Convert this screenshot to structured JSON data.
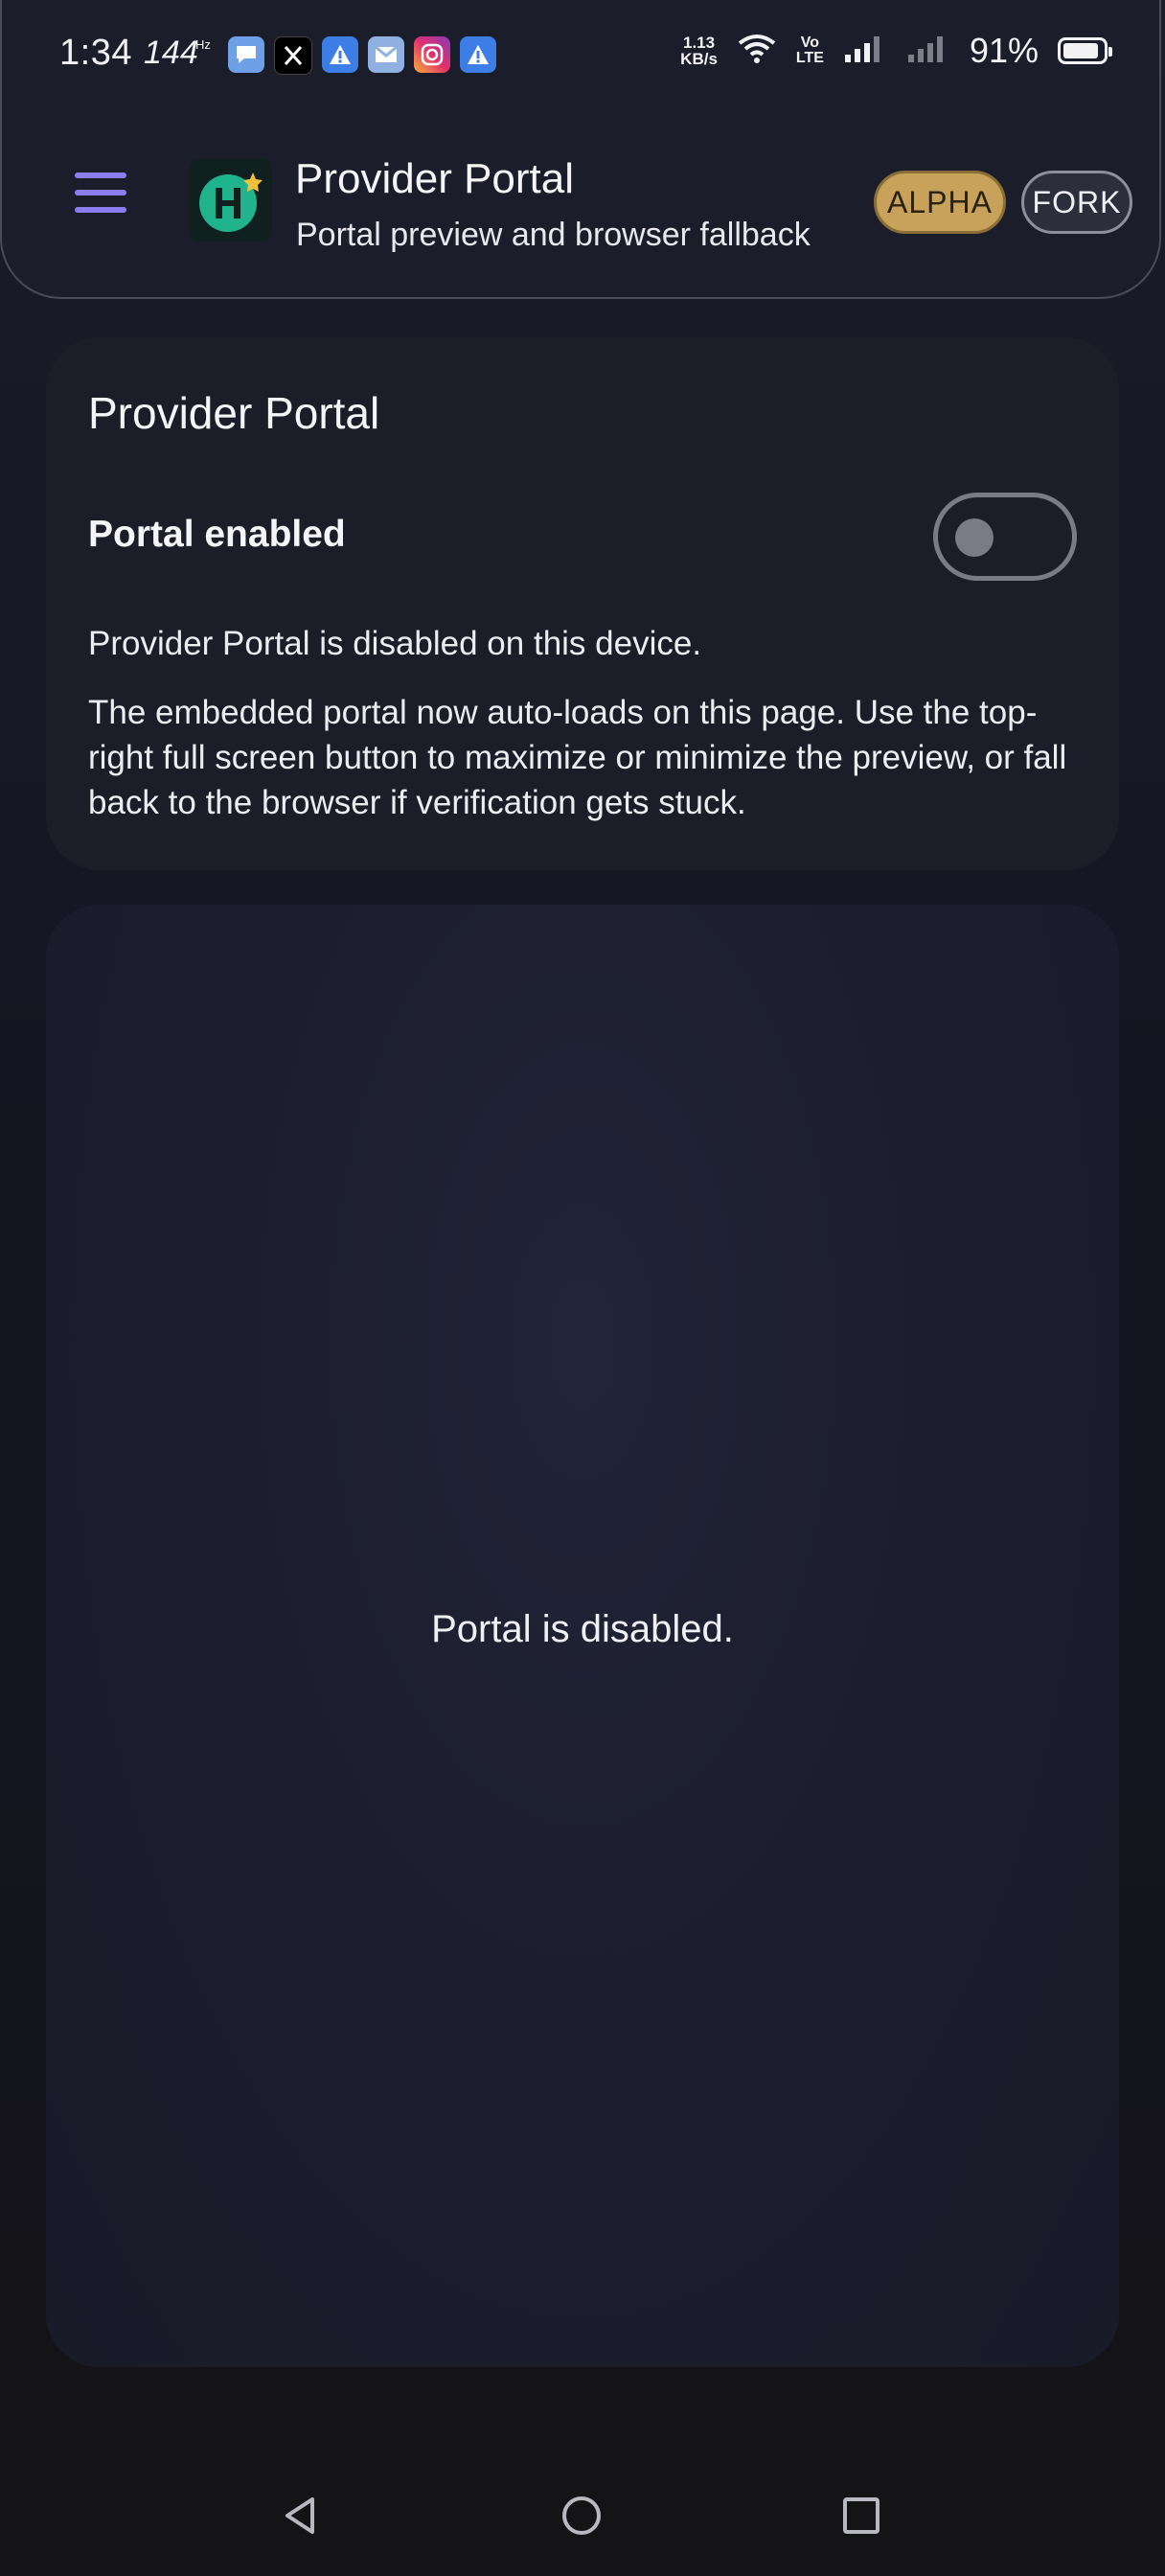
{
  "status_bar": {
    "time": "1:34",
    "refresh_rate": "144",
    "refresh_unit": "Hz",
    "net_speed_value": "1.13",
    "net_speed_unit": "KB/s",
    "volte_top": "Vo",
    "volte_bottom": "LTE",
    "battery_percent": "91%",
    "battery_level": 0.91,
    "notification_icons": [
      "messages-icon",
      "x-icon",
      "alert-icon",
      "gmail-icon",
      "instagram-icon",
      "alert-icon"
    ]
  },
  "app_bar": {
    "title": "Provider Portal",
    "subtitle": "Portal preview and browser fallback",
    "badges": {
      "alpha": "ALPHA",
      "fork": "FORK"
    },
    "colors": {
      "menu_accent": "#8c7cf0",
      "logo_green": "#1fb48c",
      "alpha_badge": "#c8a25a"
    }
  },
  "settings_card": {
    "title": "Provider Portal",
    "toggle_label": "Portal enabled",
    "toggle_on": false,
    "status_text": "Provider Portal is disabled on this device.",
    "info_text": "The embedded portal now auto-loads on this page. Use the top-right full screen button to maximize or minimize the preview, or fall back to the browser if verification gets stuck."
  },
  "preview": {
    "message": "Portal is disabled."
  }
}
